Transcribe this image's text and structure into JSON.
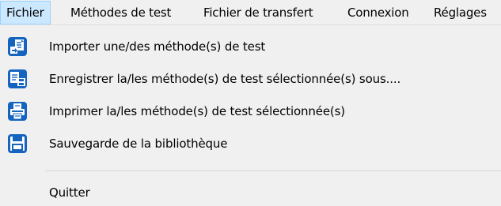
{
  "menubar": {
    "items": [
      {
        "label": "Fichier",
        "active": true
      },
      {
        "label": "Méthodes de test",
        "active": false
      },
      {
        "label": "Fichier de transfert",
        "active": false
      },
      {
        "label": "Connexion",
        "active": false
      },
      {
        "label": "Réglages",
        "active": false
      }
    ]
  },
  "dropdown": {
    "items": [
      {
        "label": "Importer une/des méthode(s) de test",
        "icon": "import-icon"
      },
      {
        "label": "Enregistrer la/les méthode(s) de test sélectionnée(s) sous....",
        "icon": "save-as-icon"
      },
      {
        "label": "Imprimer la/les méthode(s) de test sélectionnée(s)",
        "icon": "print-icon"
      },
      {
        "label": "Sauvegarde de la bibliothèque",
        "icon": "floppy-disk-icon"
      },
      {
        "label": "Quitter",
        "icon": null
      }
    ]
  },
  "colors": {
    "icon_blue": "#1565c0",
    "active_highlight": "#cce8ff",
    "active_border": "#99d1ff",
    "background": "#f0f0f0"
  }
}
